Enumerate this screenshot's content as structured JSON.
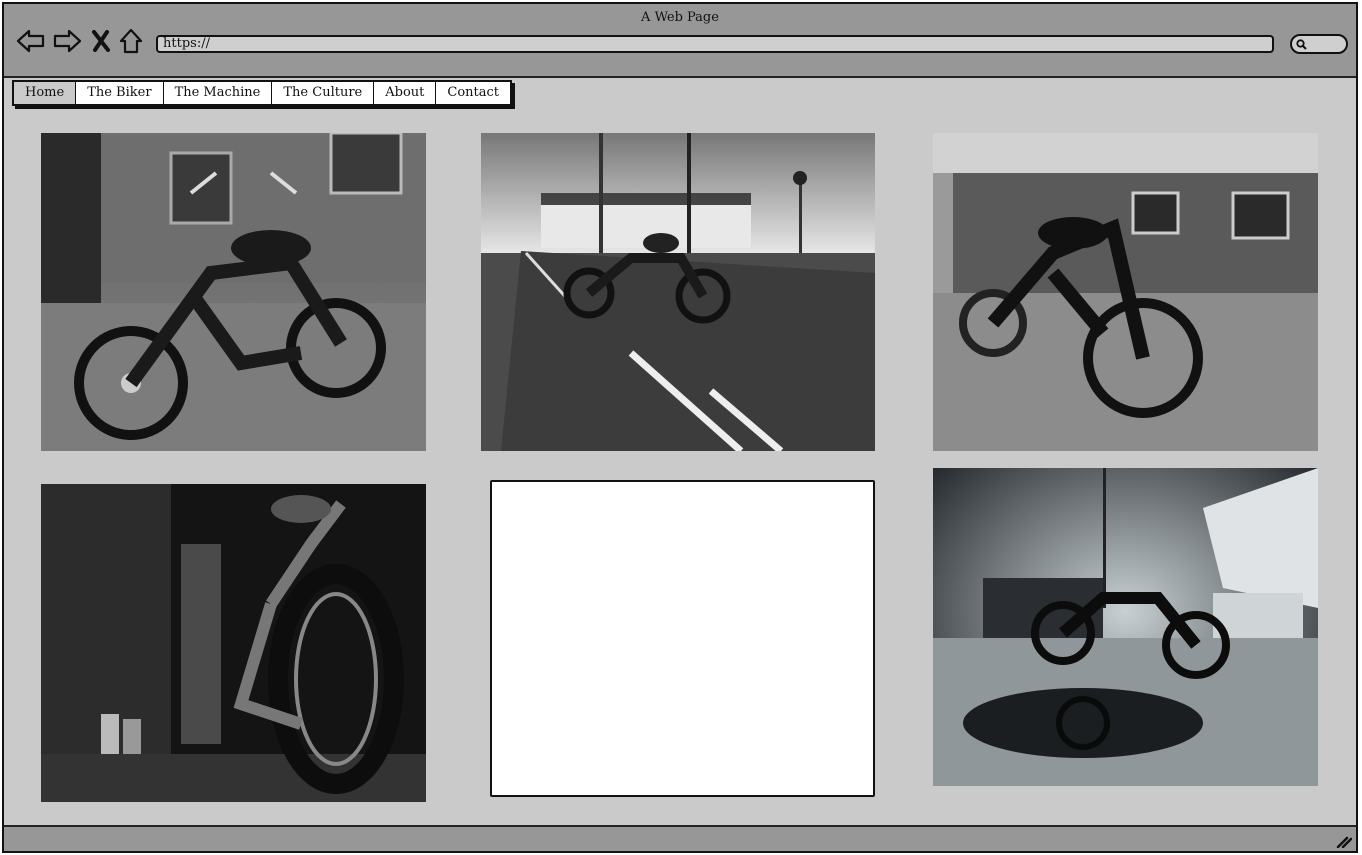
{
  "window": {
    "title": "A Web Page"
  },
  "browser": {
    "url": "https://",
    "icons": [
      "back-arrow-icon",
      "forward-arrow-icon",
      "stop-x-icon",
      "home-icon",
      "search-icon"
    ]
  },
  "nav": {
    "tabs": [
      {
        "label": "Home",
        "active": true
      },
      {
        "label": "The Biker",
        "active": false
      },
      {
        "label": "The Machine",
        "active": false
      },
      {
        "label": "The Culture",
        "active": false
      },
      {
        "label": "About",
        "active": false
      },
      {
        "label": "Contact",
        "active": false
      }
    ]
  },
  "gallery": {
    "images": [
      {
        "subject": "motorcycle parked by brick building"
      },
      {
        "subject": "motorcycle on empty road"
      },
      {
        "subject": "chopper motorcycle in front of brick house"
      },
      {
        "subject": "motorcycle in dark garage"
      },
      {
        "subject": "empty image placeholder"
      },
      {
        "subject": "motorcycle by boats with puddle reflection"
      }
    ]
  },
  "colors": {
    "chrome": "#979797",
    "page": "#cacaca",
    "border": "#111111"
  }
}
